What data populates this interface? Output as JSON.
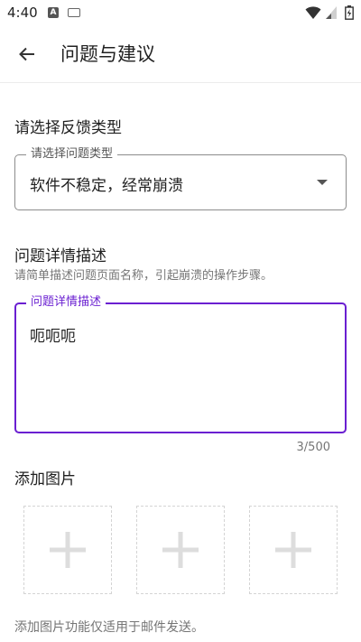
{
  "status_bar": {
    "time": "4:40",
    "a_badge": "A"
  },
  "app_bar": {
    "title": "问题与建议"
  },
  "type_section": {
    "title": "请选择反馈类型",
    "field_label": "请选择问题类型",
    "selected_value": "软件不稳定，经常崩溃"
  },
  "detail_section": {
    "title": "问题详情描述",
    "helper": "请简单描述问题页面名称，引起崩溃的操作步骤。",
    "field_label": "问题详情描述",
    "value": "呃呃呃",
    "counter": "3/500",
    "accent_color": "#6a1fd1"
  },
  "image_section": {
    "title": "添加图片",
    "note": "添加图片功能仅适用于邮件发送。"
  }
}
